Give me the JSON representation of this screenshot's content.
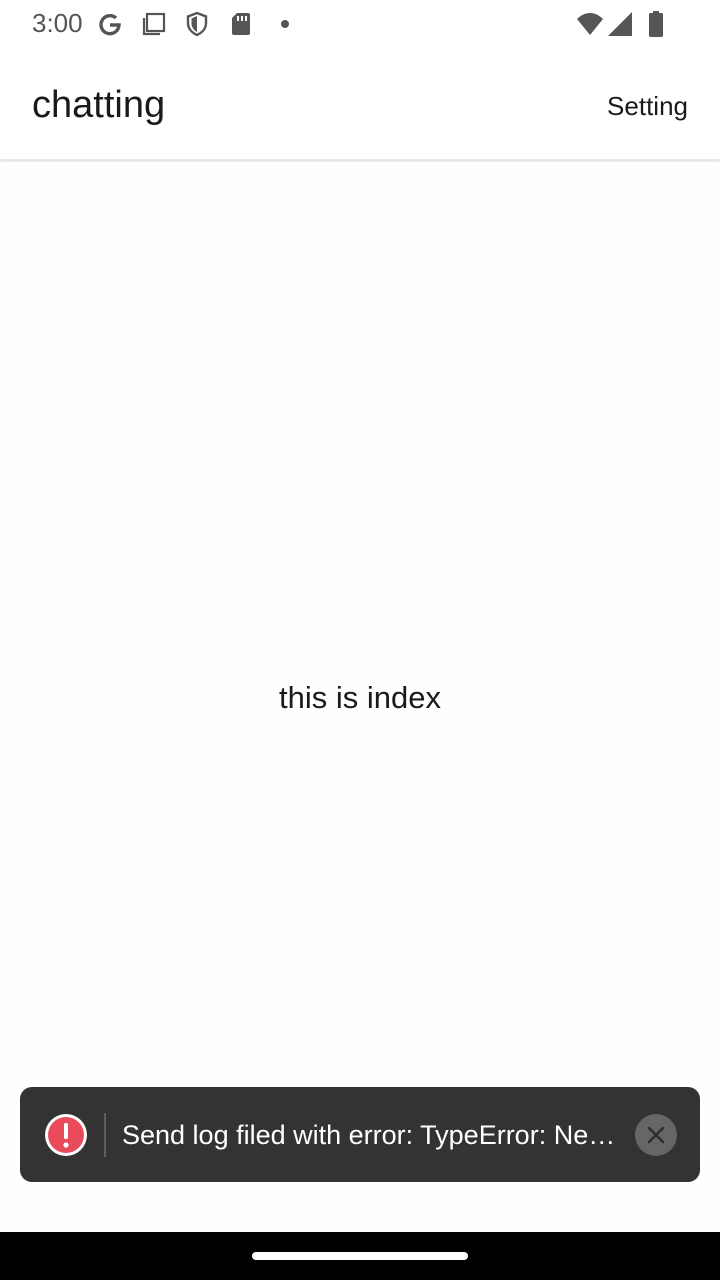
{
  "status_bar": {
    "time": "3:00",
    "icons": [
      "google-icon",
      "screenshot-icon",
      "shield-icon",
      "sd-card-icon",
      "dot-icon",
      "wifi-icon",
      "signal-icon",
      "battery-icon"
    ]
  },
  "app_bar": {
    "title": "chatting",
    "setting_label": "Setting"
  },
  "main": {
    "text": "this is index"
  },
  "toast": {
    "message": "Send log filed with error:  TypeError: Ne…",
    "icon": "error-icon",
    "close_icon": "close-icon",
    "colors": {
      "background": "#333333",
      "error": "#e94b5b"
    }
  },
  "nav_bar": {
    "handle": "home-handle"
  }
}
